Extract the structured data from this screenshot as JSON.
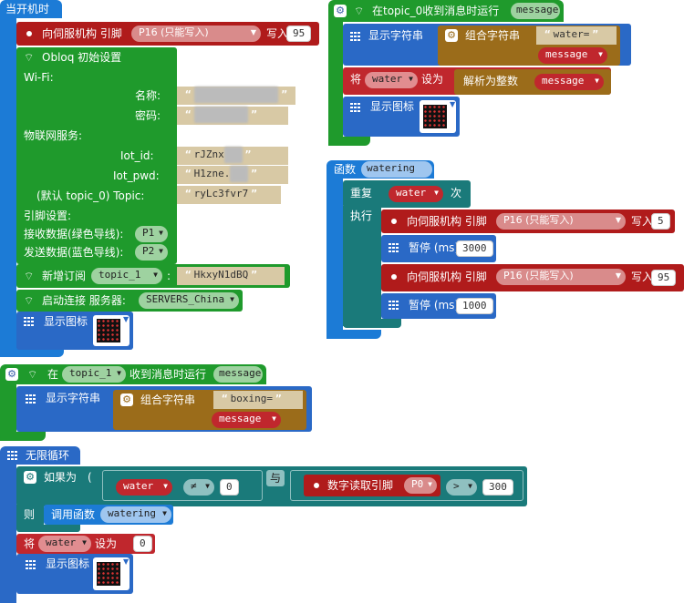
{
  "colors": {
    "control_blue": "#1c7bd6",
    "wifi_green": "#1f9a2c",
    "servo_red": "#b01b1b",
    "display_blue": "#2a69c6",
    "text_brown": "#9b6c1a",
    "logic_teal": "#1a7a7a",
    "var_red": "#c0272d"
  },
  "on_start": {
    "title": "当开机时",
    "servo": {
      "label": "向伺服机构 引脚",
      "pin": "P16 (只能写入)",
      "write": "写入",
      "value": "95"
    },
    "obloq": {
      "title": "Obloq 初始设置",
      "wifi_label": "Wi-Fi:",
      "name_label": "名称:",
      "name_value": "dlinkgeli-5a0m",
      "password_label": "密码:",
      "password_value": "dgiemsla0",
      "iot_label": "物联网服务:",
      "iot_id_label": "Iot_id:",
      "iot_id_value": "rJZnx",
      "iot_id_hidden": "q_m",
      "iot_pwd_label": "Iot_pwd:",
      "iot_pwd_value": "H1zne.",
      "iot_pwd_hidden": "gLa",
      "topic_label": "(默认 topic_0) Topic:",
      "topic_value": "ryLc3fvr7",
      "pin_label": "引脚设置:",
      "rx_label": "接收数据(绿色导线):",
      "rx_pin": "P1",
      "tx_label": "发送数据(蓝色导线):",
      "tx_pin": "P2"
    },
    "subscribe": {
      "label": "新增订阅",
      "topic": "topic_1",
      "colon": ":",
      "value": "HkxyN1dBQ"
    },
    "connect": {
      "label": "启动连接 服务器:",
      "server": "SERVERS_China"
    },
    "show_icon": "显示图标"
  },
  "topic0_handler": {
    "title": "在topic_0收到消息时运行",
    "param": "message",
    "show_string": "显示字符串",
    "join": "组合字符串",
    "join_literal": "water=",
    "join_var": "message",
    "set_label": "将",
    "set_var": "water",
    "set_to": "设为",
    "parse": "解析为整数",
    "parse_var": "message",
    "show_icon": "显示图标"
  },
  "watering_fn": {
    "title": "函数",
    "name": "watering",
    "repeat": "重复",
    "repeat_var": "water",
    "times": "次",
    "execute": "执行",
    "servo1": {
      "label": "向伺服机构 引脚",
      "pin": "P16 (只能写入)",
      "write": "写入",
      "value": "5"
    },
    "pause1": {
      "label": "暂停 (ms)",
      "value": "3000"
    },
    "servo2": {
      "label": "向伺服机构 引脚",
      "pin": "P16 (只能写入)",
      "write": "写入",
      "value": "95"
    },
    "pause2": {
      "label": "暂停 (ms)",
      "value": "1000"
    }
  },
  "topic1_handler": {
    "title_prefix": "在",
    "topic": "topic_1",
    "title_suffix": "收到消息时运行",
    "param": "message",
    "show_string": "显示字符串",
    "join": "组合字符串",
    "join_literal": "boxing=",
    "join_var": "message"
  },
  "forever": {
    "title": "无限循环",
    "if_label": "如果为",
    "cond_var": "water",
    "cond_op": "≠",
    "cond_value": "0",
    "and_label": "与",
    "read_label": "数字读取引脚",
    "read_pin": "P0",
    "cmp_op": ">",
    "cmp_value": "300",
    "then_label": "则",
    "call_label": "调用函数",
    "call_fn": "watering",
    "set_label": "将",
    "set_var": "water",
    "set_to": "设为",
    "set_value": "0",
    "show_icon": "显示图标"
  }
}
